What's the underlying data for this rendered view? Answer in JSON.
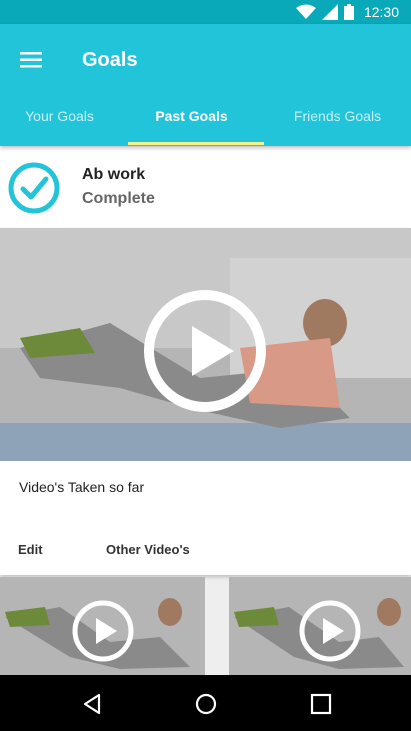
{
  "status_bar": {
    "time": "12:30",
    "icons": [
      "wifi-icon",
      "cell-signal-icon",
      "battery-icon"
    ]
  },
  "header": {
    "title": "Goals",
    "menu_icon": "hamburger-menu-icon"
  },
  "tabs": [
    {
      "label": "Your Goals",
      "active": false
    },
    {
      "label": "Past Goals",
      "active": true
    },
    {
      "label": "Friends Goals",
      "active": false
    }
  ],
  "goal": {
    "title": "Ab work",
    "status": "Complete",
    "icon": "check-circle-icon"
  },
  "video_card": {
    "caption": "Video's Taken so far",
    "actions": {
      "edit": "Edit",
      "other": "Other Video's"
    },
    "icon": "play-icon"
  },
  "thumbnails": [
    {
      "icon": "play-icon"
    },
    {
      "icon": "play-icon"
    }
  ],
  "nav": [
    "back-icon",
    "home-icon",
    "recents-icon"
  ],
  "colors": {
    "status_bar": "#0aa9b9",
    "app_bar": "#21c4d8",
    "tab_indicator": "#f1f38a",
    "check": "#21c4d8"
  }
}
